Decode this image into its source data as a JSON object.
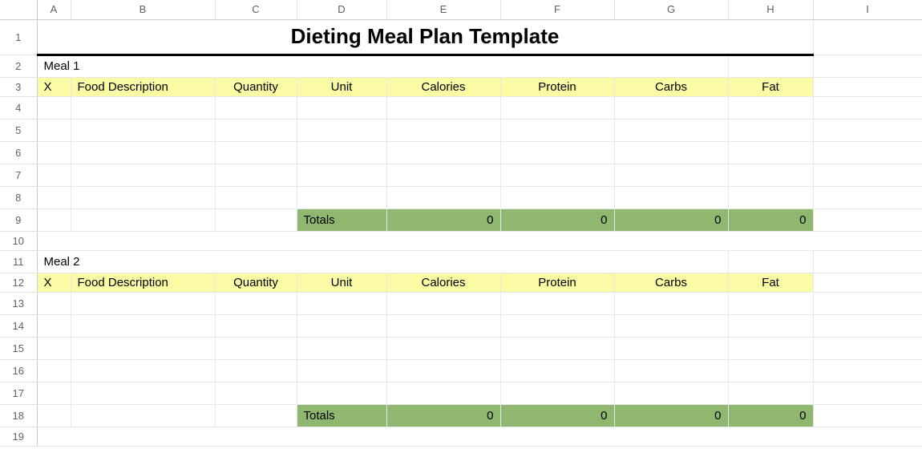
{
  "columns": [
    "A",
    "B",
    "C",
    "D",
    "E",
    "F",
    "G",
    "H",
    "I"
  ],
  "rows": [
    "1",
    "2",
    "3",
    "4",
    "5",
    "6",
    "7",
    "8",
    "9",
    "10",
    "11",
    "12",
    "13",
    "14",
    "15",
    "16",
    "17",
    "18",
    "19"
  ],
  "title": "Dieting Meal Plan Template",
  "headers": {
    "x": "X",
    "food": "Food Description",
    "qty": "Quantity",
    "unit": "Unit",
    "cal": "Calories",
    "pro": "Protein",
    "carb": "Carbs",
    "fat": "Fat"
  },
  "totals_label": "Totals",
  "meals": [
    {
      "label": "Meal 1",
      "rows": [
        {
          "x": "",
          "food": "",
          "qty": "",
          "unit": "",
          "cal": "",
          "pro": "",
          "carb": "",
          "fat": ""
        },
        {
          "x": "",
          "food": "",
          "qty": "",
          "unit": "",
          "cal": "",
          "pro": "",
          "carb": "",
          "fat": ""
        },
        {
          "x": "",
          "food": "",
          "qty": "",
          "unit": "",
          "cal": "",
          "pro": "",
          "carb": "",
          "fat": ""
        },
        {
          "x": "",
          "food": "",
          "qty": "",
          "unit": "",
          "cal": "",
          "pro": "",
          "carb": "",
          "fat": ""
        },
        {
          "x": "",
          "food": "",
          "qty": "",
          "unit": "",
          "cal": "",
          "pro": "",
          "carb": "",
          "fat": ""
        }
      ],
      "totals": {
        "cal": "0",
        "pro": "0",
        "carb": "0",
        "fat": "0"
      }
    },
    {
      "label": "Meal 2",
      "rows": [
        {
          "x": "",
          "food": "",
          "qty": "",
          "unit": "",
          "cal": "",
          "pro": "",
          "carb": "",
          "fat": ""
        },
        {
          "x": "",
          "food": "",
          "qty": "",
          "unit": "",
          "cal": "",
          "pro": "",
          "carb": "",
          "fat": ""
        },
        {
          "x": "",
          "food": "",
          "qty": "",
          "unit": "",
          "cal": "",
          "pro": "",
          "carb": "",
          "fat": ""
        },
        {
          "x": "",
          "food": "",
          "qty": "",
          "unit": "",
          "cal": "",
          "pro": "",
          "carb": "",
          "fat": ""
        },
        {
          "x": "",
          "food": "",
          "qty": "",
          "unit": "",
          "cal": "",
          "pro": "",
          "carb": "",
          "fat": ""
        }
      ],
      "totals": {
        "cal": "0",
        "pro": "0",
        "carb": "0",
        "fat": "0"
      }
    }
  ]
}
